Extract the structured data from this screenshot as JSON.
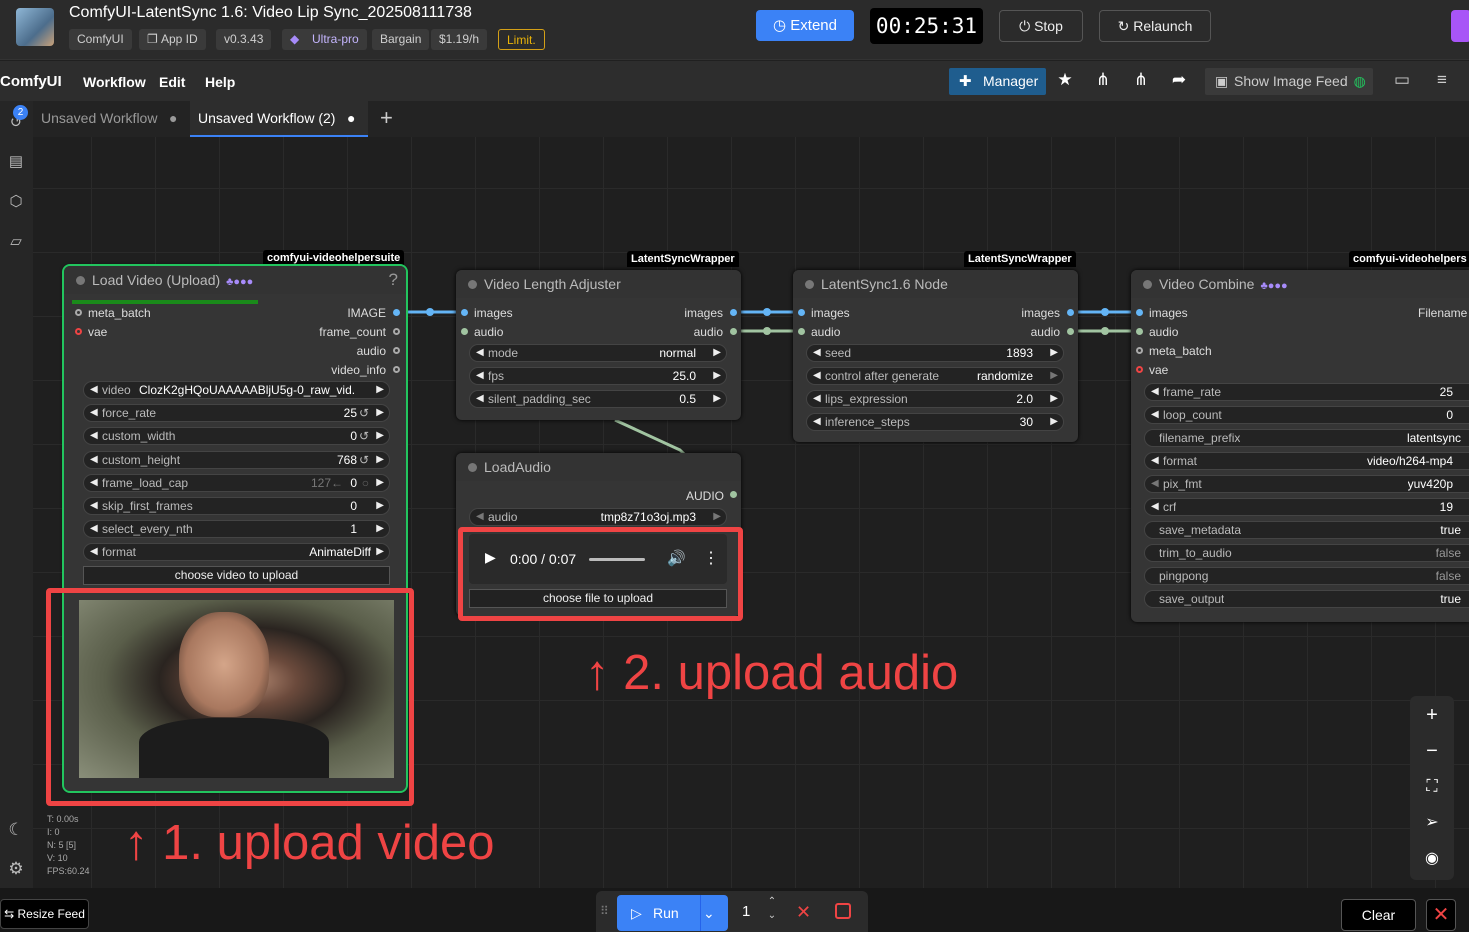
{
  "window": {
    "title": "ComfyUI-LatentSync 1.6: Video Lip Sync_202508111738",
    "chips": [
      "ComfyUI",
      "App ID",
      "v0.3.43",
      "Ultra-pro",
      "Bargain",
      "$1.19/h",
      "Limit."
    ],
    "extend_label": "Extend",
    "timer": "00:25:31",
    "stop_label": "Stop",
    "relaunch_label": "Relaunch"
  },
  "menubar": {
    "logo": "ComfyUI",
    "items": [
      "Workflow",
      "Edit",
      "Help"
    ],
    "manager_label": "Manager",
    "feed_label": "Show Image Feed"
  },
  "tabs": [
    {
      "label": "Unsaved Workflow",
      "active": false
    },
    {
      "label": "Unsaved Workflow (2)",
      "active": true
    }
  ],
  "sidebar": {
    "queue_badge": "2"
  },
  "nodes": {
    "load_video": {
      "badge": "comfyui-videohelpersuite",
      "title": "Load Video (Upload)",
      "help": "?",
      "inputs": [
        "meta_batch",
        "vae"
      ],
      "outputs": [
        "IMAGE",
        "frame_count",
        "audio",
        "video_info"
      ],
      "widgets": [
        {
          "label": "video",
          "value": "ClozK2gHQoUAAAAABljU5g-0_raw_vid..."
        },
        {
          "label": "force_rate",
          "value": "25"
        },
        {
          "label": "custom_width",
          "value": "0"
        },
        {
          "label": "custom_height",
          "value": "768"
        },
        {
          "label": "frame_load_cap",
          "value": "0",
          "hint": "127←"
        },
        {
          "label": "skip_first_frames",
          "value": "0"
        },
        {
          "label": "select_every_nth",
          "value": "1"
        },
        {
          "label": "format",
          "value": "AnimateDiff"
        }
      ],
      "upload_label": "choose video to upload"
    },
    "video_length": {
      "badge": "LatentSyncWrapper",
      "title": "Video Length Adjuster",
      "inputs": [
        "images",
        "audio"
      ],
      "outputs": [
        "images",
        "audio"
      ],
      "widgets": [
        {
          "label": "mode",
          "value": "normal"
        },
        {
          "label": "fps",
          "value": "25.0"
        },
        {
          "label": "silent_padding_sec",
          "value": "0.5"
        }
      ]
    },
    "latentsync": {
      "badge": "LatentSyncWrapper",
      "title": "LatentSync1.6 Node",
      "inputs": [
        "images",
        "audio"
      ],
      "outputs": [
        "images",
        "audio"
      ],
      "widgets": [
        {
          "label": "seed",
          "value": "1893"
        },
        {
          "label": "control after generate",
          "value": "randomize"
        },
        {
          "label": "lips_expression",
          "value": "2.0"
        },
        {
          "label": "inference_steps",
          "value": "30"
        }
      ]
    },
    "load_audio": {
      "title": "LoadAudio",
      "output": "AUDIO",
      "widget": {
        "label": "audio",
        "value": "tmp8z71o3oj.mp3"
      },
      "player_time": "0:00 / 0:07",
      "upload_label": "choose file to upload"
    },
    "video_combine": {
      "badge": "comfyui-videohelpers",
      "title": "Video Combine",
      "inputs": [
        "images",
        "audio",
        "meta_batch",
        "vae"
      ],
      "output": "Filename",
      "widgets": [
        {
          "label": "frame_rate",
          "value": "25"
        },
        {
          "label": "loop_count",
          "value": "0"
        },
        {
          "label": "filename_prefix",
          "value": "latentsync"
        },
        {
          "label": "format",
          "value": "video/h264-mp4"
        },
        {
          "label": "pix_fmt",
          "value": "yuv420p"
        },
        {
          "label": "crf",
          "value": "19"
        },
        {
          "label": "save_metadata",
          "value": "true"
        },
        {
          "label": "trim_to_audio",
          "value": "false"
        },
        {
          "label": "pingpong",
          "value": "false"
        },
        {
          "label": "save_output",
          "value": "true"
        }
      ]
    }
  },
  "annotations": {
    "upload_video": "↑ 1. upload video",
    "upload_audio": "↑ 2. upload audio"
  },
  "stats": [
    "T: 0.00s",
    "I: 0",
    "N: 5 [5]",
    "V: 10",
    "FPS:60.24"
  ],
  "bottom": {
    "resize_feed": "Resize Feed",
    "run_label": "Run",
    "batch_count": "1",
    "clear_label": "Clear"
  },
  "colors": {
    "accent": "#3b82f6",
    "annotation_red": "#ef4444",
    "image_link": "#64b5f6",
    "audio_link": "#a1c4a1",
    "selected_outline": "#22c55e"
  }
}
